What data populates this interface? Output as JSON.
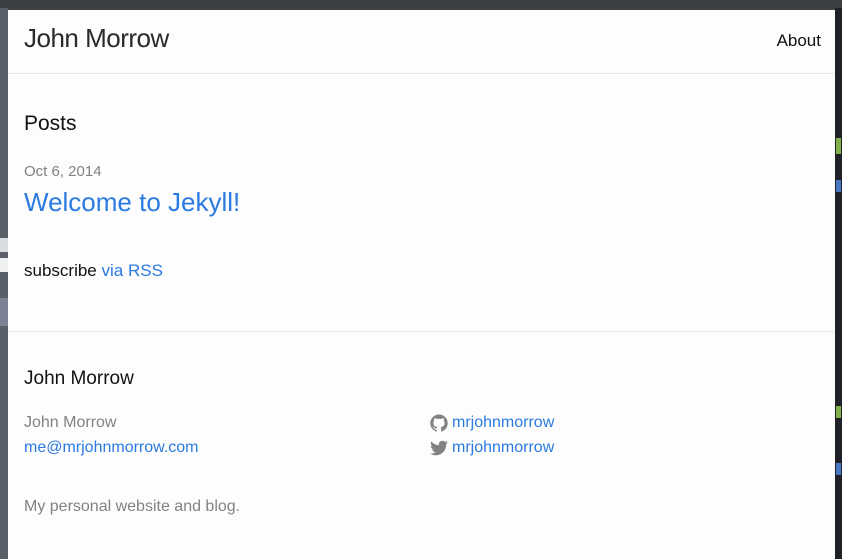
{
  "header": {
    "site_title": "John Morrow",
    "nav": [
      {
        "label": "About"
      }
    ]
  },
  "main": {
    "heading": "Posts",
    "posts": [
      {
        "date": "Oct 6, 2014",
        "title": "Welcome to Jekyll!"
      }
    ],
    "subscribe_text": "subscribe",
    "subscribe_link": "via RSS"
  },
  "footer": {
    "heading": "John Morrow",
    "name": "John Morrow",
    "email": "me@mrjohnmorrow.com",
    "github_username": "mrjohnmorrow",
    "twitter_username": "mrjohnmorrow",
    "description": "My personal website and blog."
  },
  "colors": {
    "link": "#2a7ae2",
    "muted": "#828282",
    "text": "#111111",
    "icon": "#828282"
  },
  "icons": {
    "github": "github-icon",
    "twitter": "twitter-icon"
  }
}
